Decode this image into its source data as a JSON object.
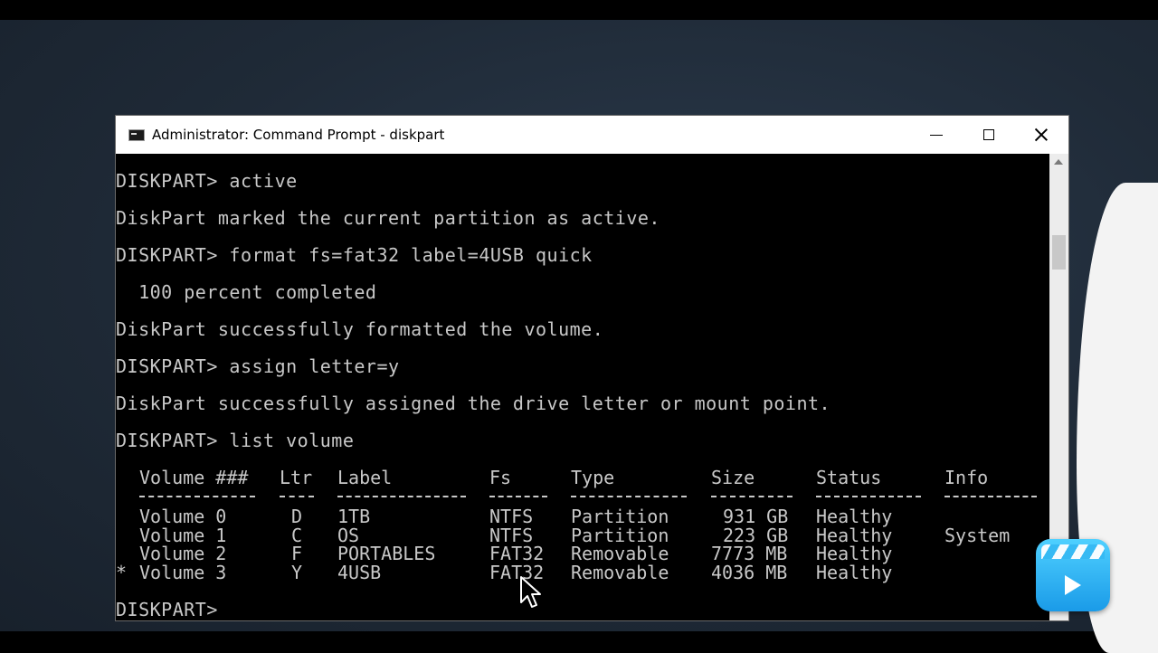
{
  "window": {
    "title": "Administrator: Command Prompt - diskpart",
    "icon": "cmd-icon"
  },
  "console": {
    "lines": [
      "DISKPART> active",
      "DiskPart marked the current partition as active.",
      "DISKPART> format fs=fat32 label=4USB quick",
      "  100 percent completed",
      "DiskPart successfully formatted the volume.",
      "DISKPART> assign letter=y",
      "DiskPart successfully assigned the drive letter or mount point.",
      "DISKPART> list volume",
      "DISKPART>"
    ],
    "volume_table": {
      "headers": [
        "Volume ###",
        "Ltr",
        "Label",
        "Fs",
        "Type",
        "Size",
        "Status",
        "Info"
      ],
      "rows": [
        {
          "marker": "",
          "volume": "Volume 0",
          "ltr": "D",
          "label": "1TB",
          "fs": "NTFS",
          "type": "Partition",
          "size": "931 GB",
          "status": "Healthy",
          "info": ""
        },
        {
          "marker": "",
          "volume": "Volume 1",
          "ltr": "C",
          "label": "OS",
          "fs": "NTFS",
          "type": "Partition",
          "size": "223 GB",
          "status": "Healthy",
          "info": "System"
        },
        {
          "marker": "",
          "volume": "Volume 2",
          "ltr": "F",
          "label": "PORTABLES",
          "fs": "FAT32",
          "type": "Removable",
          "size": "7773 MB",
          "status": "Healthy",
          "info": ""
        },
        {
          "marker": "*",
          "volume": "Volume 3",
          "ltr": "Y",
          "label": "4USB",
          "fs": "FAT32",
          "type": "Removable",
          "size": "4036 MB",
          "status": "Healthy",
          "info": ""
        }
      ]
    }
  },
  "colors": {
    "console_bg": "#000000",
    "console_text": "#c8c8c8",
    "titlebar_bg": "#ffffff",
    "desktop_bg": "#243141",
    "badge_blue": "#1a9be8"
  },
  "overlay": {
    "icon": "video-editor-app-icon"
  }
}
